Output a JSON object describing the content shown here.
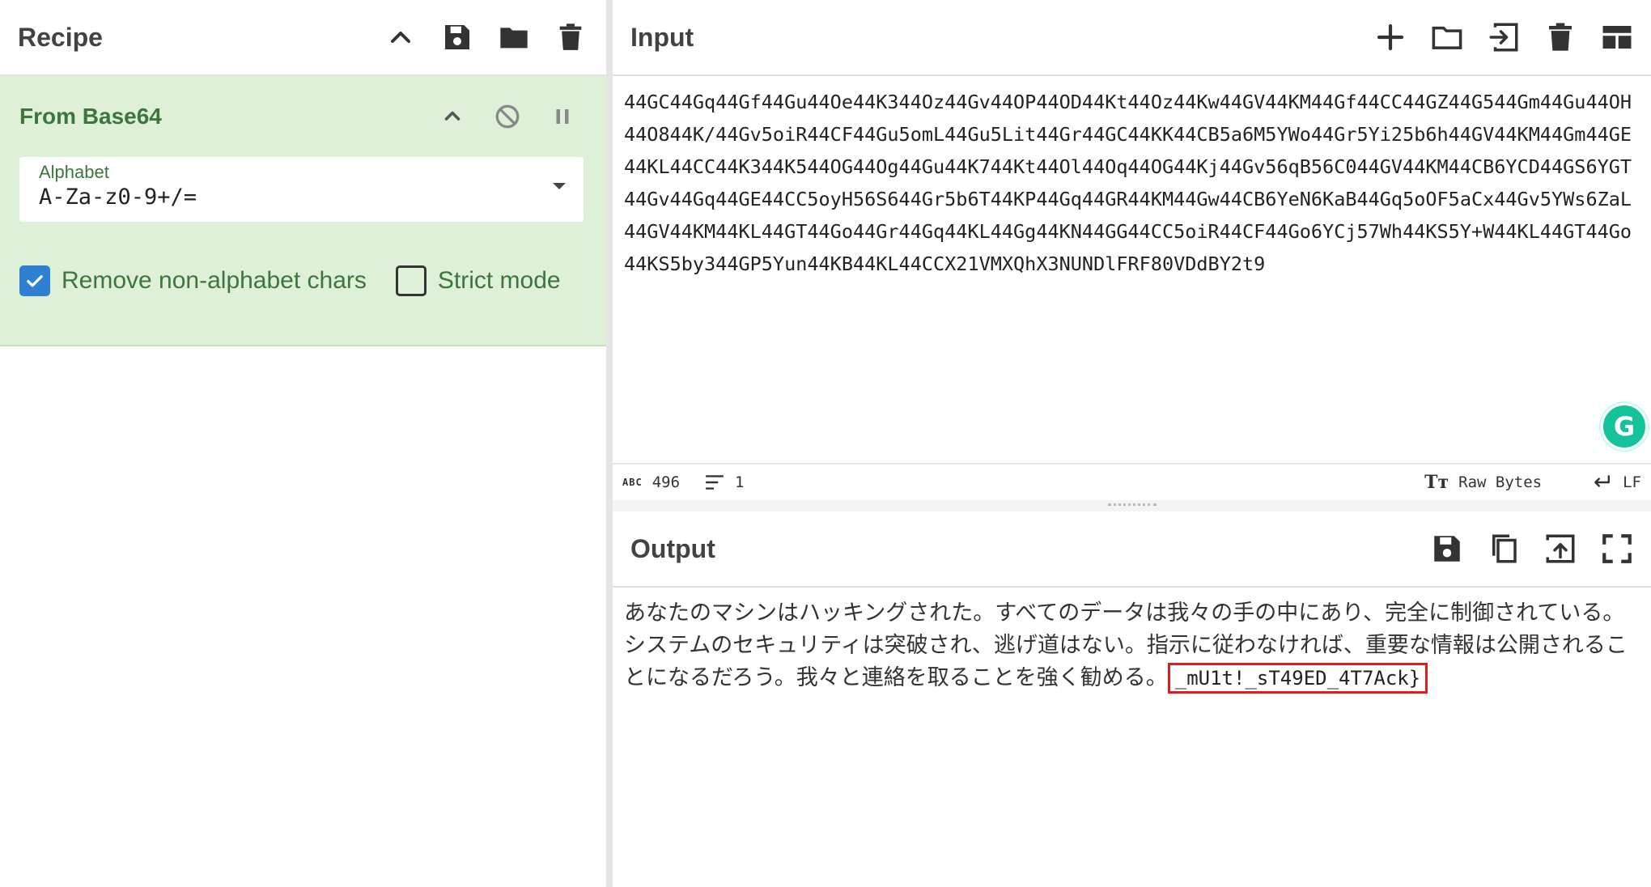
{
  "recipe": {
    "title": "Recipe",
    "operation": {
      "title": "From Base64",
      "alphabet_label": "Alphabet",
      "alphabet_value": "A-Za-z0-9+/=",
      "remove_nonalpha_label": "Remove non-alphabet chars",
      "remove_nonalpha_checked": true,
      "strict_mode_label": "Strict mode",
      "strict_mode_checked": false
    }
  },
  "input": {
    "title": "Input",
    "text": "44GC44Gq44Gf44Gu44Oe44K344Oz44Gv44OP44OD44Kt44Oz44Kw44GV44KM44Gf44CC44GZ44G544Gm44Gu44OH44O844K/44Gv5oiR44CF44Gu5omL44Gu5Lit44Gr44GC44KK44CB5a6M5YWo44Gr5Yi25b6h44GV44KM44Gm44GE44KL44CC44K344K544OG44Og44Gu44K744Kt44Ol44Oq44OG44Kj44Gv56qB56C044GV44KM44CB6YCD44GS6YGT44Gv44Gq44GE44CC5oyH56S644Gr5b6T44KP44Gq44GR44KM44Gw44CB6YeN6KaB44Gq5oOF5aCx44Gv5YWs6ZaL44GV44KM44KL44GT44Go44Gr44Gq44KL44Gg44KN44GG44CC5oiR44CF44Go6YCj57Wh44KS5Y+W44KL44GT44Go44KS5by344GP5Yun44KB44KL44CCX21VMXQhX3NUNDlFRF80VDdBY2t9",
    "char_count": "496",
    "line_count": "1",
    "encoding_label": "Raw Bytes",
    "eol_label": "LF"
  },
  "output": {
    "title": "Output",
    "text": "あなたのマシンはハッキングされた。すべてのデータは我々の手の中にあり、完全に制御されている。システムのセキュリティは突破され、逃げ道はない。指示に従わなければ、重要な情報は公開されることになるだろう。我々と連絡を取ることを強く勧める。",
    "flag": "_mU1t!_sT49ED_4T7Ack}"
  },
  "colors": {
    "op_bg": "#dff0d8",
    "op_text": "#3c763d",
    "checkbox": "#2f80d1",
    "highlight": "#e31b1b"
  }
}
